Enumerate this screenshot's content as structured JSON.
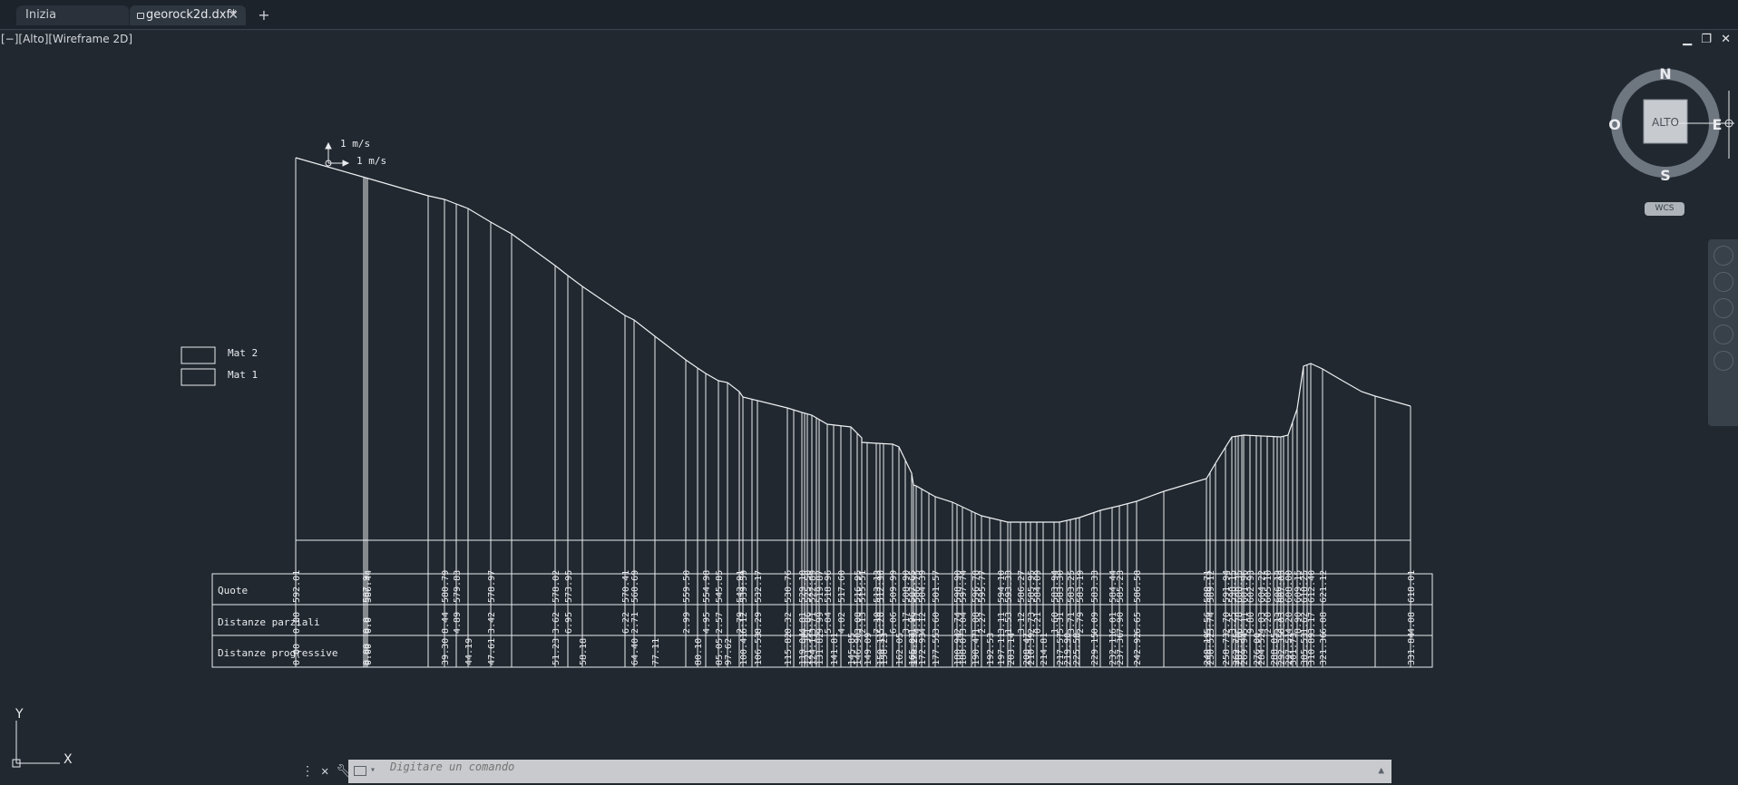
{
  "tabs": {
    "home": "Inizia",
    "document": "georock2d.dxf*"
  },
  "viewport": {
    "label": "[−][Alto][Wireframe 2D]"
  },
  "window_controls": {
    "minimize": "▁",
    "restore": "❐",
    "close": "✕"
  },
  "viewcube": {
    "north": "N",
    "south": "S",
    "east": "E",
    "west": "O",
    "top": "ALTO",
    "wcs": "WCS"
  },
  "ucs": {
    "x": "X",
    "y": "Y"
  },
  "command": {
    "placeholder": "Digitare un comando"
  },
  "drawing": {
    "scale_label_v": "1 m/s",
    "scale_label_h": "1 m/s",
    "legend": [
      "Mat 2",
      "Mat 1"
    ],
    "row_labels": [
      "Quote",
      "Distanze parziali",
      "Distanze progressive"
    ],
    "quote_labels": [
      "592.01",
      "587.9",
      "586.44",
      "580.79",
      "579.83",
      "578.97",
      "578.02",
      "573.95",
      "570.41",
      "560.69",
      "559.50",
      "554.98",
      "545.85",
      "543.91",
      "539.59",
      "532.17",
      "530.76",
      "529.10",
      "525.50",
      "522.89",
      "519.87",
      "518.96",
      "517.60",
      "516.95",
      "515.51",
      "513.13",
      "512.90",
      "509.99",
      "508.90",
      "507.65",
      "506.75",
      "504.39",
      "501.57",
      "598.90",
      "597.74",
      "596.78",
      "595.77",
      "594.10",
      "593.33",
      "586.27",
      "585.95",
      "584.09",
      "583.94",
      "583.30",
      "583.25",
      "583.19",
      "583.33",
      "584.44",
      "585.23",
      "586.58",
      "588.71",
      "589.12",
      "591.94",
      "598.15",
      "600.35",
      "601.96",
      "602.93",
      "604.22",
      "605.10",
      "606.13",
      "607.05",
      "608.00",
      "609.15",
      "610.25",
      "612.40",
      "621.12",
      "618.01"
    ],
    "parziali_labels": [
      "0.00",
      "0.0",
      "0.0",
      "8.44",
      "4.89",
      "3.42",
      "3.62",
      "6.95",
      "6.22",
      "2.71",
      "2.99",
      "4.95",
      "2.57",
      "2.79",
      "6.12",
      "8.29",
      "0.32",
      "4.01",
      "1.06",
      "3.71",
      "9.99",
      "5.04",
      "4.02",
      "3.08",
      "2.13",
      "7.10",
      "5.20",
      "6.06",
      "3.17",
      "1.96",
      "4.17",
      "4.12",
      "3.60",
      "2.74",
      "3.04",
      "1.08",
      "2.27",
      "3.11",
      "1.53",
      "3.12",
      "2.73",
      "0.21",
      "1.60",
      "5.31",
      "3.71",
      "2.79",
      "0.09",
      "6.01",
      "7.90",
      "6.65",
      "5.56",
      "3.74",
      "2.70",
      "3.25",
      "6.78",
      "5.11",
      "9.80",
      "4.03",
      "2.20",
      "3.13",
      "6.03",
      "4.20",
      "8.90",
      "1.62",
      "3.17",
      "6.08",
      "4.08"
    ],
    "progressive_labels": [
      "0.00",
      "0.00",
      "0.00",
      "39.30",
      "44.19",
      "47.61",
      "51.23",
      "58.18",
      "64.40",
      "77.11",
      "80.10",
      "85.05",
      "97.62",
      "100.41",
      "106.53",
      "115.82",
      "119.04",
      "121.35",
      "124.11",
      "131.82",
      "141.81",
      "145.85",
      "146.90",
      "149.09",
      "150.11",
      "158.23",
      "162.05",
      "165.07",
      "170.29",
      "172.93",
      "177.55",
      "180.94",
      "188.07",
      "190.47",
      "192.53",
      "197.11",
      "203.14",
      "208.47",
      "210.39",
      "214.81",
      "217.57",
      "219.90",
      "225.58",
      "229.15",
      "232.11",
      "237.36",
      "242.92",
      "248.19",
      "250.52",
      "258.73",
      "262.75",
      "267.56",
      "269.94",
      "276.00",
      "284.52",
      "288.05",
      "292.35",
      "297.51",
      "301.73",
      "305.53",
      "310.89",
      "321.36",
      "331.84"
    ]
  }
}
